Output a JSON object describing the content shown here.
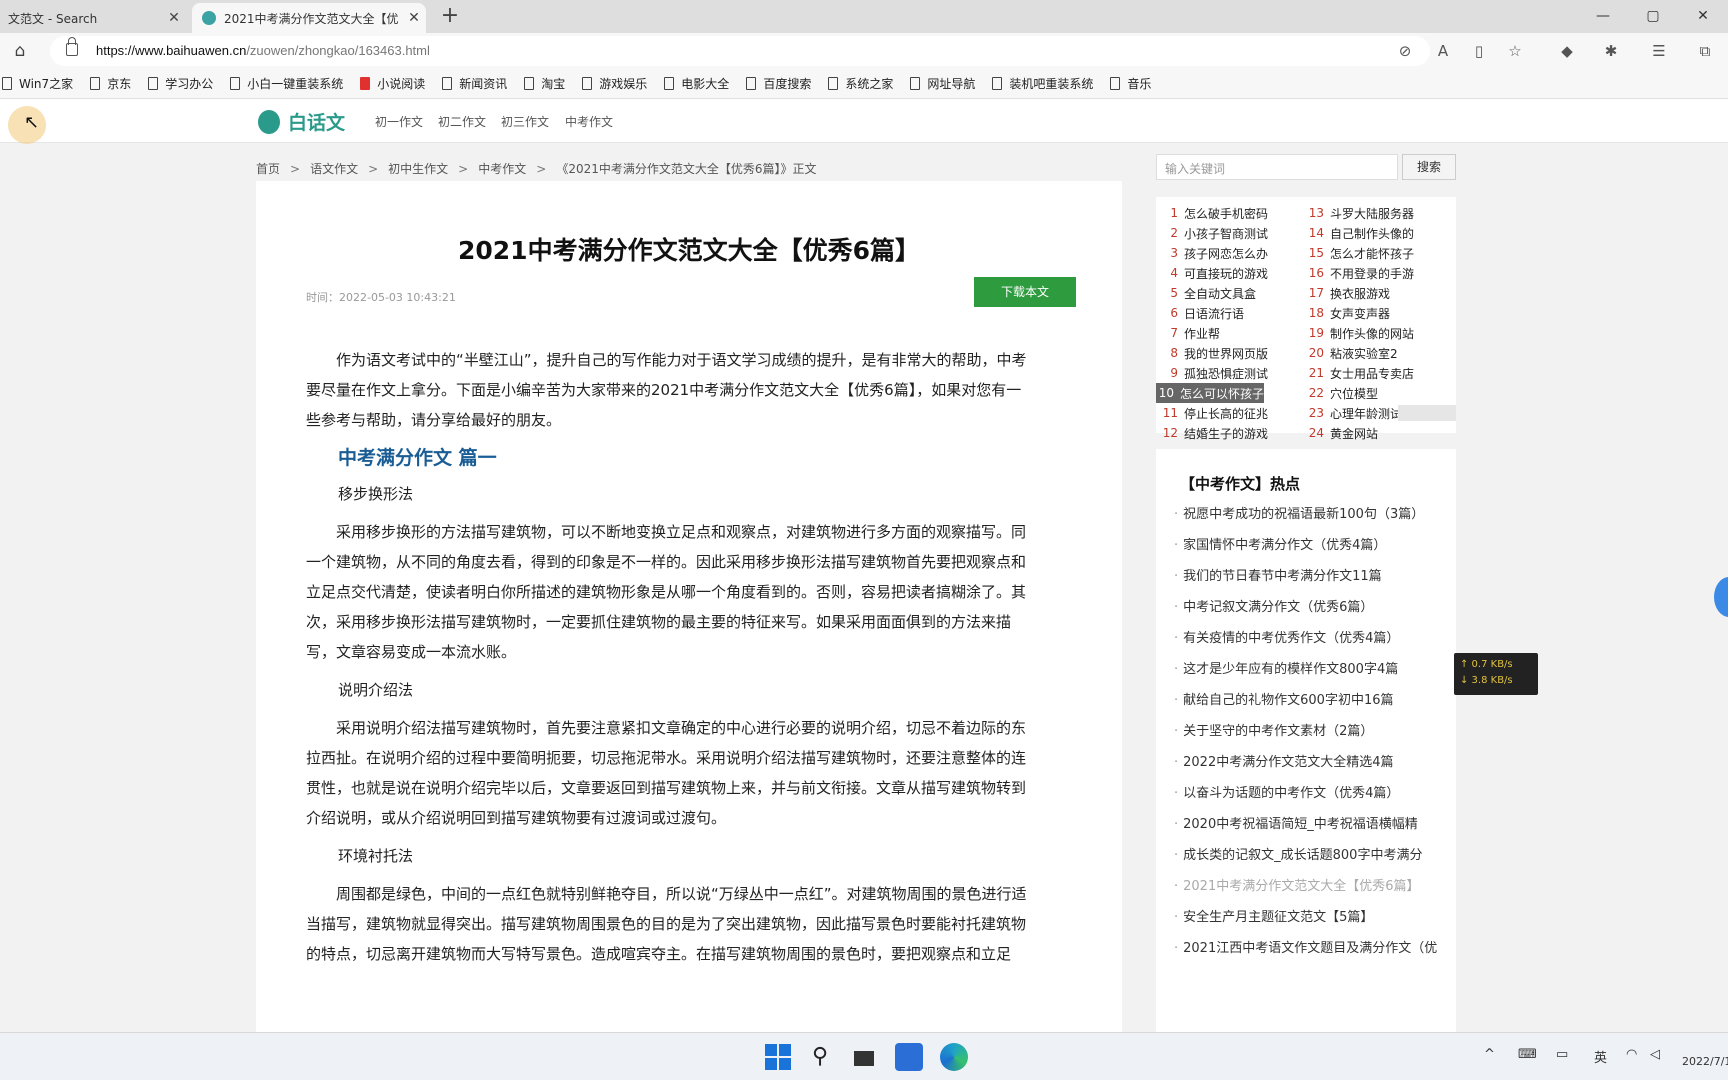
{
  "browser": {
    "tabs": [
      {
        "label": "文范文 - Search",
        "close": "✕",
        "active": false
      },
      {
        "label": "2021中考满分作文范文大全【优",
        "close": "✕",
        "active": true
      }
    ],
    "new_tab": "+",
    "window_controls": [
      "—",
      "▢",
      "✕"
    ],
    "url_host": "https://www.baihuawen.cn",
    "url_path": "/zuowen/zhongkao/163463.html"
  },
  "bookmarks": [
    {
      "label": "Win7之家"
    },
    {
      "label": "京东"
    },
    {
      "label": "学习办公"
    },
    {
      "label": "小白一键重装系统"
    },
    {
      "label": "小说阅读",
      "red": true
    },
    {
      "label": "新闻资讯"
    },
    {
      "label": "淘宝"
    },
    {
      "label": "游戏娱乐"
    },
    {
      "label": "电影大全"
    },
    {
      "label": "百度搜索"
    },
    {
      "label": "系统之家"
    },
    {
      "label": "网址导航"
    },
    {
      "label": "装机吧重装系统"
    },
    {
      "label": "音乐"
    }
  ],
  "site": {
    "logo_text": "白话文",
    "nav": [
      "初一作文",
      "初二作文",
      "初三作文",
      "中考作文"
    ],
    "breadcrumb": [
      "首页",
      "语文作文",
      "初中生作文",
      "中考作文",
      "《2021中考满分作文范文大全【优秀6篇】》正文"
    ],
    "search_placeholder": "输入关键词",
    "search_button": "搜索"
  },
  "article": {
    "title": "2021中考满分作文范文大全【优秀6篇】",
    "meta": "时间：2022-05-03 10:43:21",
    "download": "下载本文",
    "intro": "作为语文考试中的“半壁江山”，提升自己的写作能力对于语文学习成绩的提升，是有非常大的帮助，中考要尽量在作文上拿分。下面是小编辛苦为大家带来的2021中考满分作文范文大全【优秀6篇】，如果对您有一些参考与帮助，请分享给最好的朋友。",
    "heading1": "中考满分作文 篇一",
    "sub1": "移步换形法",
    "para1": "采用移步换形的方法描写建筑物，可以不断地变换立足点和观察点，对建筑物进行多方面的观察描写。同一个建筑物，从不同的角度去看，得到的印象是不一样的。因此采用移步换形法描写建筑物首先要把观察点和立足点交代清楚，使读者明白你所描述的建筑物形象是从哪一个角度看到的。否则，容易把读者搞糊涂了。其次，采用移步换形法描写建筑物时，一定要抓住建筑物的最主要的特征来写。如果采用面面俱到的方法来描写，文章容易变成一本流水账。",
    "sub2": "说明介绍法",
    "para2": "采用说明介绍法描写建筑物时，首先要注意紧扣文章确定的中心进行必要的说明介绍，切忌不着边际的东拉西扯。在说明介绍的过程中要简明扼要，切忌拖泥带水。采用说明介绍法描写建筑物时，还要注意整体的连贯性，也就是说在说明介绍完毕以后，文章要返回到描写建筑物上来，并与前文衔接。文章从描写建筑物转到介绍说明，或从介绍说明回到描写建筑物要有过渡词或过渡句。",
    "sub3": "环境衬托法",
    "para3": "周围都是绿色，中间的一点红色就特别鲜艳夺目，所以说“万绿丛中一点红”。对建筑物周围的景色进行适当描写，建筑物就显得突出。描写建筑物周围景色的目的是为了突出建筑物，因此描写景色时要能衬托建筑物的特点，切忌离开建筑物而大写特写景色。造成喧宾夺主。在描写建筑物周围的景色时，要把观察点和立足"
  },
  "hot_left": [
    {
      "n": "1",
      "t": "怎么破手机密码"
    },
    {
      "n": "2",
      "t": "小孩子智商测试"
    },
    {
      "n": "3",
      "t": "孩子网恋怎么办"
    },
    {
      "n": "4",
      "t": "可直接玩的游戏"
    },
    {
      "n": "5",
      "t": "全自动文具盒"
    },
    {
      "n": "6",
      "t": "日语流行语"
    },
    {
      "n": "7",
      "t": "作业帮"
    },
    {
      "n": "8",
      "t": "我的世界网页版"
    },
    {
      "n": "9",
      "t": "孤独恐惧症测试"
    },
    {
      "n": "10",
      "t": "怎么可以怀孩子",
      "sel": true
    },
    {
      "n": "11",
      "t": "停止长高的征兆"
    },
    {
      "n": "12",
      "t": "结婚生子的游戏"
    }
  ],
  "hot_right": [
    {
      "n": "13",
      "t": "斗罗大陆服务器"
    },
    {
      "n": "14",
      "t": "自己制作头像的"
    },
    {
      "n": "15",
      "t": "怎么才能怀孩子"
    },
    {
      "n": "16",
      "t": "不用登录的手游"
    },
    {
      "n": "17",
      "t": "换衣服游戏"
    },
    {
      "n": "18",
      "t": "女声变声器"
    },
    {
      "n": "19",
      "t": "制作头像的网站"
    },
    {
      "n": "20",
      "t": "粘液实验室2"
    },
    {
      "n": "21",
      "t": "女士用品专卖店"
    },
    {
      "n": "22",
      "t": "穴位模型"
    },
    {
      "n": "23",
      "t": "心理年龄测试题"
    },
    {
      "n": "24",
      "t": "黄金网站"
    }
  ],
  "news": {
    "title": "【中考作文】热点",
    "items": [
      {
        "t": "祝愿中考成功的祝福语最新100句（3篇）"
      },
      {
        "t": "家国情怀中考满分作文（优秀4篇）"
      },
      {
        "t": "我们的节日春节中考满分作文11篇"
      },
      {
        "t": "中考记叙文满分作文（优秀6篇）"
      },
      {
        "t": "有关疫情的中考优秀作文（优秀4篇）"
      },
      {
        "t": "这才是少年应有的模样作文800字4篇"
      },
      {
        "t": "献给自己的礼物作文600字初中16篇"
      },
      {
        "t": "关于坚守的中考作文素材（2篇）"
      },
      {
        "t": "2022中考满分作文范文大全精选4篇"
      },
      {
        "t": "以奋斗为话题的中考作文（优秀4篇）"
      },
      {
        "t": "2020中考祝福语简短_中考祝福语横幅精"
      },
      {
        "t": "成长类的记叙文_成长话题800字中考满分"
      },
      {
        "t": "2021中考满分作文范文大全【优秀6篇】",
        "dim": true
      },
      {
        "t": "安全生产月主题征文范文【5篇】"
      },
      {
        "t": "2021江西中考语文作文题目及满分作文（优"
      }
    ]
  },
  "speed": {
    "up": "↑ 0.7 KB/s",
    "down": "↓ 3.8 KB/s"
  },
  "taskbar": {
    "tray": [
      "^",
      "⌨",
      "▭",
      "英",
      "◠",
      "◁"
    ],
    "clock": "2022/7/1"
  }
}
